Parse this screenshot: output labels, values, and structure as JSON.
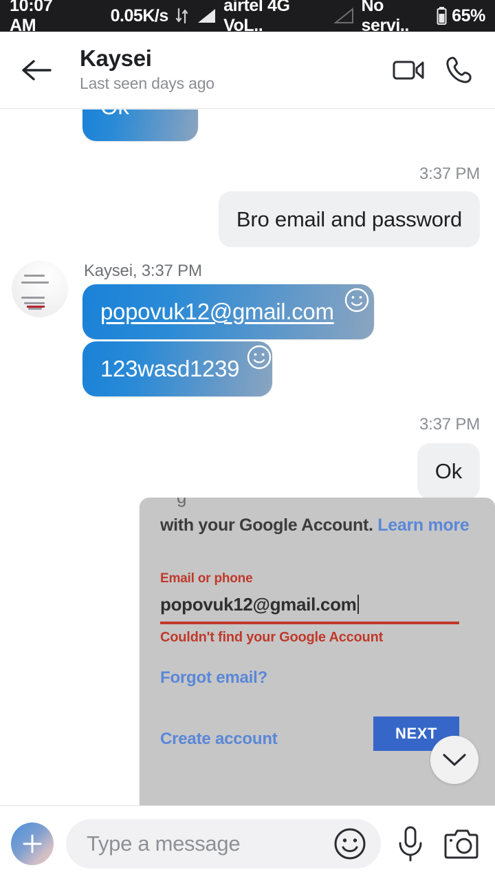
{
  "status_bar": {
    "clock": "10:07 AM",
    "network_speed": "0.05K/s",
    "data_arrows_icon": "data-transfer-arrows-icon",
    "signal_icon_1": "signal-bars-icon",
    "carrier": "airtel 4G VoL..",
    "signal_icon_2": "signal-bars-empty-icon",
    "sim2_status": "No servi..",
    "battery_icon": "battery-icon",
    "battery_percent": "65%"
  },
  "header": {
    "back_icon": "back-arrow-icon",
    "contact_name": "Kaysei",
    "contact_status": "Last seen days ago",
    "video_call_icon": "video-camera-icon",
    "voice_call_icon": "phone-icon"
  },
  "conversation": {
    "sender_label": "Kaysei, 3:37 PM",
    "avatar_name": "kaysei-avatar",
    "messages": [
      {
        "id": "msg-ok-top",
        "direction": "incoming",
        "text": "Ok",
        "clipped": "true"
      },
      {
        "id": "msg-bro-email",
        "direction": "outgoing",
        "timestamp": "3:37 PM",
        "text": "Bro email and password"
      },
      {
        "id": "msg-email",
        "direction": "incoming",
        "text": "popovuk12@gmail.com",
        "is_link": "true",
        "reaction_icon": "smiley-reaction-icon"
      },
      {
        "id": "msg-password",
        "direction": "incoming",
        "text": "123wasd1239",
        "reaction_icon": "smiley-reaction-icon"
      },
      {
        "id": "msg-ok-reply",
        "direction": "outgoing",
        "timestamp": "3:37 PM",
        "text": "Ok"
      }
    ],
    "image_attachment": {
      "name": "google-signin-screenshot",
      "line1_text": "with your Google Account. ",
      "learn_more": "Learn more",
      "field_label": "Email or phone",
      "field_value": "popovuk12@gmail.com",
      "error_text": "Couldn't find your Google Account",
      "forgot_email": "Forgot email?",
      "create_account": "Create account",
      "next_button": "NEXT"
    },
    "scroll_to_bottom_icon": "chevron-down-icon"
  },
  "composer": {
    "add_icon": "plus-icon",
    "input_value": "",
    "input_placeholder": "Type a message",
    "emoji_icon": "smiley-face-icon",
    "mic_icon": "microphone-icon",
    "camera_icon": "camera-icon"
  },
  "colors": {
    "status_bar_bg": "#1c1c1e",
    "incoming_bubble_start": "#1a82d8",
    "incoming_bubble_end": "#8ba5bf",
    "outgoing_bubble_bg": "#eff0f2",
    "accent_blue": "#3667c8",
    "error_red": "#c0392b",
    "link_blue": "#5a87d8"
  }
}
